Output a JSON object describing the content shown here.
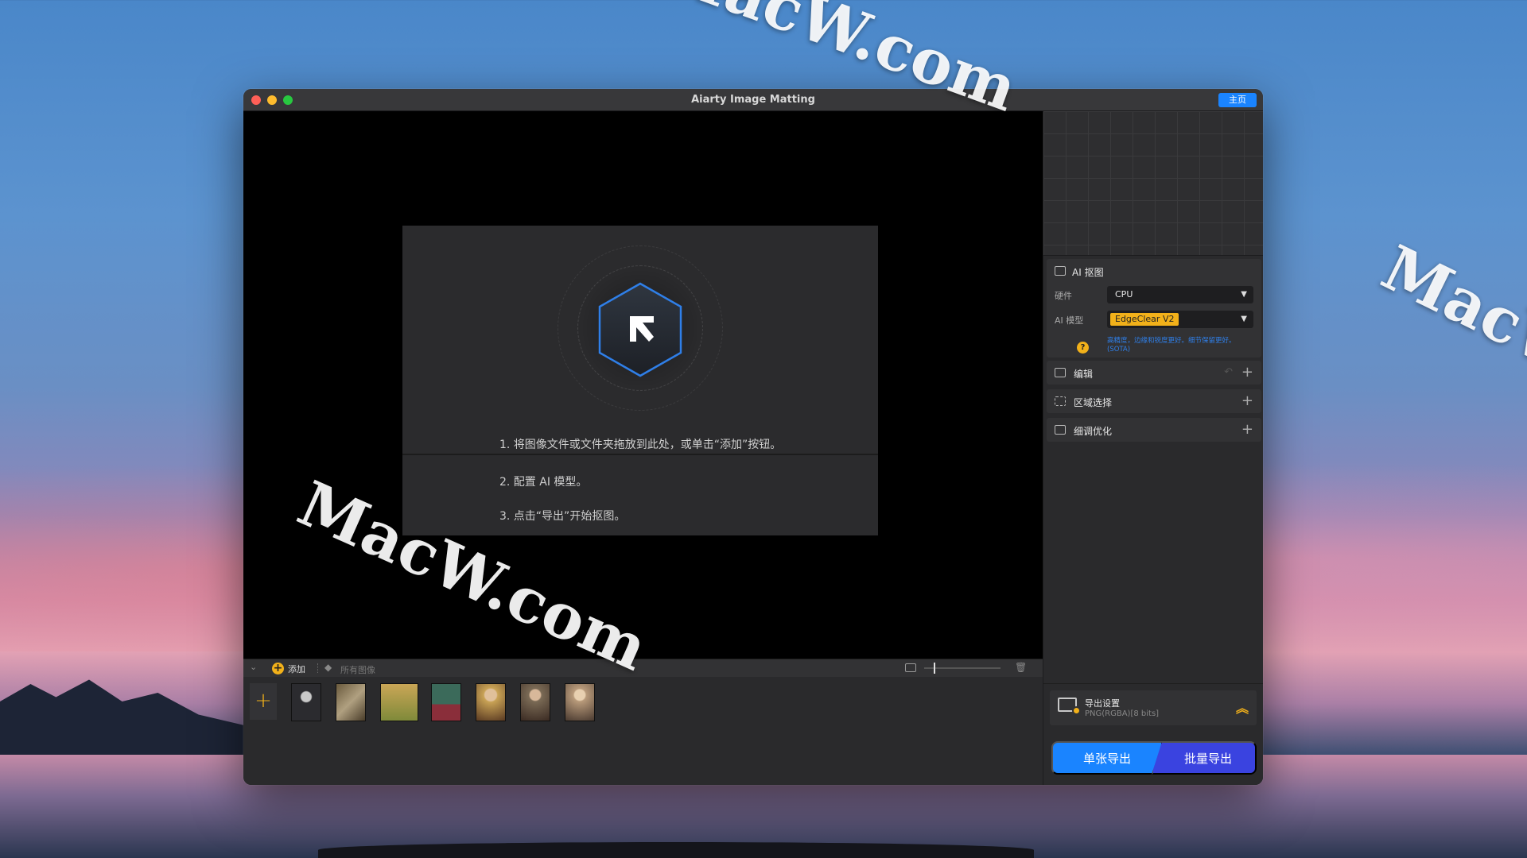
{
  "watermarks": [
    "MacW.com",
    "MacW.com",
    "MacW.com"
  ],
  "window": {
    "title": "Aiarty Image Matting",
    "home_button": "主页"
  },
  "dropzone": {
    "step1": "1. 将图像文件或文件夹拖放到此处，或单击“添加”按钮。",
    "step2": "2. 配置 AI 模型。",
    "step3": "3. 点击“导出”开始抠图。"
  },
  "bottom_toolbar": {
    "add_label": "添加",
    "all_images_label": "所有图像",
    "add_tile_symbol": "+"
  },
  "thumbnails": [
    {
      "name": "thumb-jellyfish",
      "colors": [
        "#2b2b2f",
        "#c9c9c9"
      ]
    },
    {
      "name": "thumb-bird",
      "colors": [
        "#6a5a3d",
        "#b0a080"
      ]
    },
    {
      "name": "thumb-bicycle",
      "colors": [
        "#7f8a3a",
        "#caa656"
      ]
    },
    {
      "name": "thumb-forest-woman",
      "colors": [
        "#3b6a5a",
        "#8a2e3a"
      ]
    },
    {
      "name": "thumb-woman-flowers",
      "colors": [
        "#c8a255",
        "#5a3a22"
      ]
    },
    {
      "name": "thumb-woman-portrait",
      "colors": [
        "#7a6a55",
        "#3a2a22"
      ]
    },
    {
      "name": "thumb-woman-dress",
      "colors": [
        "#b89a7a",
        "#4a3a30"
      ]
    }
  ],
  "ai_panel": {
    "title": "AI 抠图",
    "hardware_label": "硬件",
    "hardware_value": "CPU",
    "model_label": "AI 模型",
    "model_value": "EdgeClear  V2",
    "help_symbol": "?",
    "help_text": "高精度，边缘和锐度更好。细节保留更好。(SOTA)"
  },
  "sections": {
    "edit": "编辑",
    "region": "区域选择",
    "refine": "细调优化"
  },
  "export": {
    "settings_title": "导出设置",
    "settings_value": "PNG(RGBA)[8 bits]",
    "single_button": "单张导出",
    "batch_button": "批量导出"
  },
  "colors": {
    "accent_blue": "#1a84ff",
    "accent_yellow": "#f2b11a",
    "batch_purple": "#3a43e0"
  }
}
